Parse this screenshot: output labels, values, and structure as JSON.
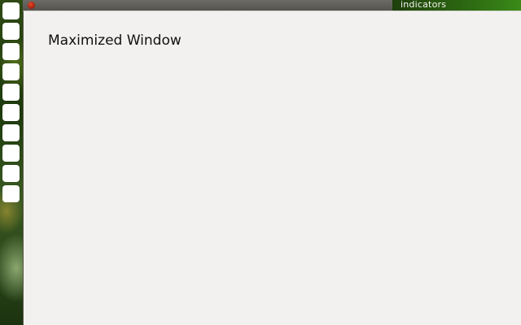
{
  "panel": {
    "indicators_label": "indicators"
  },
  "launcher": {
    "item_count": 10,
    "item_names": [
      "launcher-item-1",
      "launcher-item-2",
      "launcher-item-3",
      "launcher-item-4",
      "launcher-item-5",
      "launcher-item-6",
      "launcher-item-7",
      "launcher-item-8",
      "launcher-item-9",
      "launcher-item-10"
    ]
  },
  "window": {
    "title": "Maximized Window"
  },
  "colors": {
    "panel": "#5f5d58",
    "window_bg": "#f2f1ef",
    "close_button": "#c0301a",
    "indicators_bg": "#2d6a12"
  }
}
